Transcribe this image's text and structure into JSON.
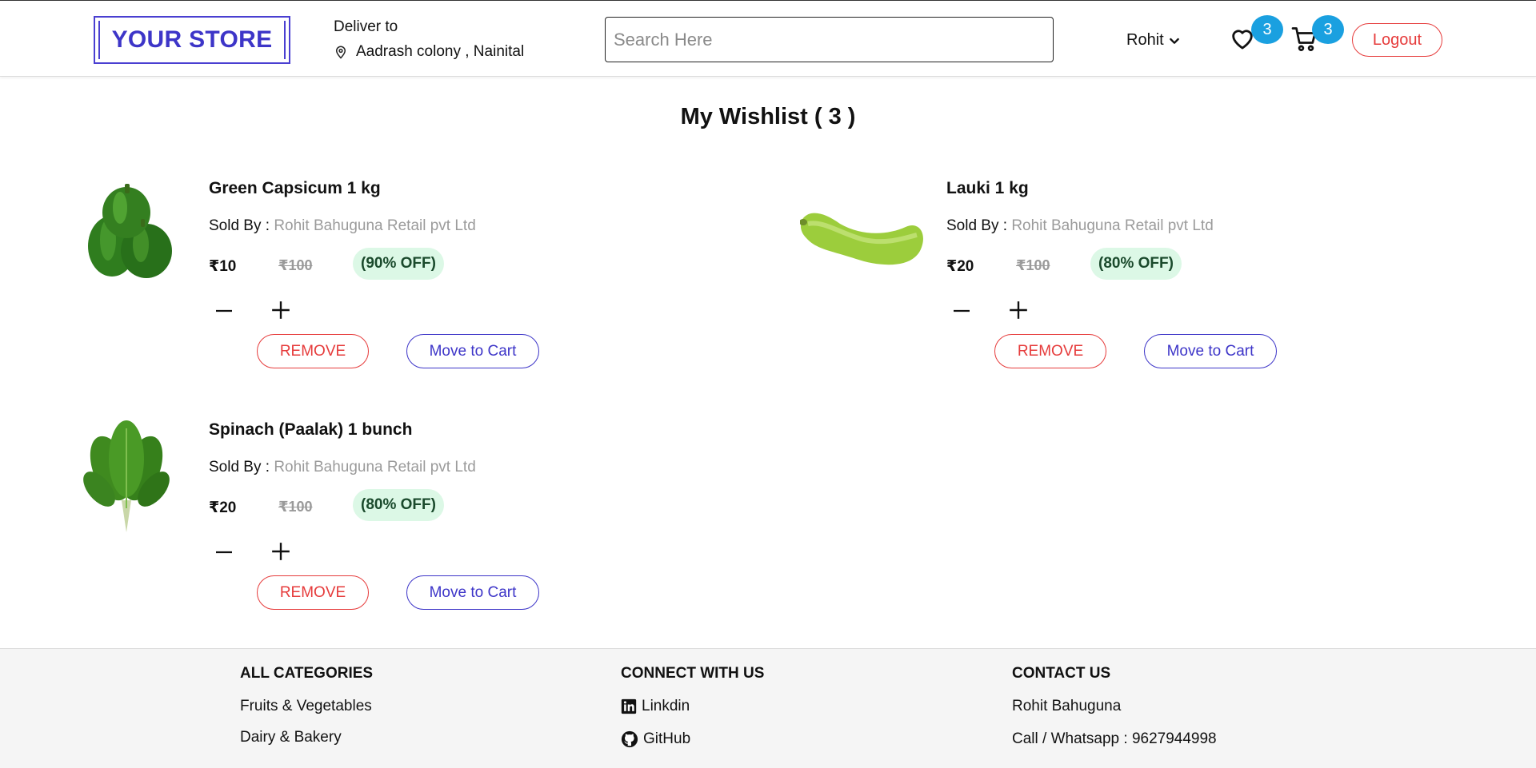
{
  "header": {
    "logo_text": "YOUR STORE",
    "deliver_label": "Deliver to",
    "deliver_address": "Aadrash colony , Nainital",
    "search_placeholder": "Search Here",
    "user_name": "Rohit",
    "wishlist_count": "3",
    "cart_count": "3",
    "logout_label": "Logout",
    "badge_color": "#1aa0e0",
    "brand_color": "#3d35c8",
    "danger_color": "#e63b3b"
  },
  "main": {
    "title": "My Wishlist ( 3 )",
    "products": [
      {
        "name": "Green Capsicum 1 kg",
        "sold_by_label": "Sold By :",
        "seller": "Rohit Bahuguna Retail pvt Ltd",
        "price": "₹10",
        "mrp": "₹100",
        "discount": "(90% OFF)",
        "remove_label": "REMOVE",
        "cart_label": "Move to Cart",
        "image": "green-capsicum"
      },
      {
        "name": "Lauki 1 kg",
        "sold_by_label": "Sold By :",
        "seller": "Rohit Bahuguna Retail pvt Ltd",
        "price": "₹20",
        "mrp": "₹100",
        "discount": "(80% OFF)",
        "remove_label": "REMOVE",
        "cart_label": "Move to Cart",
        "image": "bottle-gourd"
      },
      {
        "name": "Spinach (Paalak) 1 bunch",
        "sold_by_label": "Sold By :",
        "seller": "Rohit Bahuguna Retail pvt Ltd",
        "price": "₹20",
        "mrp": "₹100",
        "discount": "(80% OFF)",
        "remove_label": "REMOVE",
        "cart_label": "Move to Cart",
        "image": "spinach"
      }
    ]
  },
  "footer": {
    "categories_title": "ALL CATEGORIES",
    "categories": [
      "Fruits & Vegetables",
      "Dairy & Bakery"
    ],
    "connect_title": "CONNECT WITH US",
    "links": [
      "Linkdin",
      "GitHub"
    ],
    "contact_title": "CONTACT US",
    "contact_name": "Rohit Bahuguna",
    "contact_phone": "Call / Whatsapp : 9627944998"
  }
}
